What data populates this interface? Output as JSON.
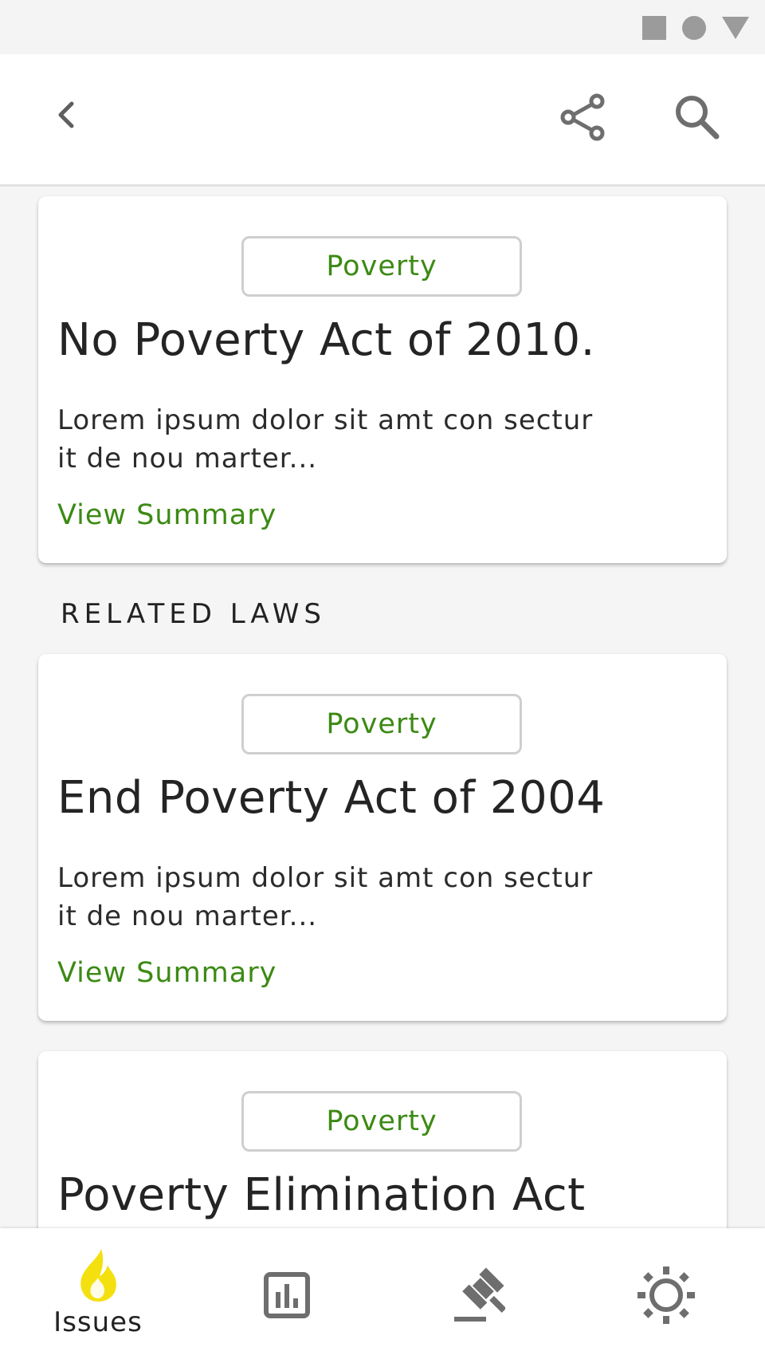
{
  "status_bar": {
    "icons": [
      "square-icon",
      "circle-icon",
      "triangle-icon"
    ]
  },
  "app_bar": {
    "icons": [
      "back-icon",
      "share-icon",
      "search-icon"
    ]
  },
  "cards": [
    {
      "tag": "Poverty",
      "title": "No Poverty Act of 2010.",
      "description": "Lorem ipsum dolor sit amt con sectur it de nou marter...",
      "link": "View Summary"
    },
    {
      "tag": "Poverty",
      "title": "End Poverty Act of 2004",
      "description": "Lorem ipsum dolor sit amt con sectur it de nou marter...",
      "link": "View Summary"
    },
    {
      "tag": "Poverty",
      "title": "Poverty Elimination Act"
    }
  ],
  "section_label": "RELATED LAWS",
  "bottom_nav": {
    "items": [
      {
        "label": "Issues",
        "icon": "flame-icon",
        "active": true
      },
      {
        "icon": "chart-icon"
      },
      {
        "icon": "gavel-icon"
      },
      {
        "icon": "sun-icon"
      }
    ]
  },
  "colors": {
    "accent": "#3c8a14",
    "flame": "#f5e00f",
    "icon_gray": "#6e6e6e"
  }
}
